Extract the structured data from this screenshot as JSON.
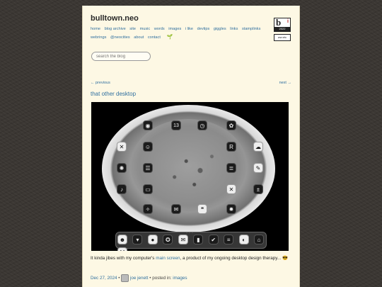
{
  "site": {
    "title": "bulltown.neo",
    "nav": [
      "home",
      "blog archive",
      "site",
      "music",
      "words",
      "images",
      "i like",
      "devtips",
      "giggles",
      "links",
      "stamplinks",
      "webrings",
      "@neocities",
      "about",
      "contact"
    ],
    "sprout_icon": "sprout-icon"
  },
  "badges": {
    "logo_letter": "b",
    "logo_accent": "i",
    "year": "2022",
    "webmaster": "ww:etc"
  },
  "search": {
    "placeholder": "search the blog"
  },
  "pager": {
    "prev": "← previous",
    "next": "next →"
  },
  "post": {
    "title": "that other desktop",
    "caption_before": "It kinda jibes with my computer's ",
    "caption_link": "main screen",
    "caption_after": ", a product of my ongoing desktop design therapy... 😎",
    "date": "Dec 27, 2024",
    "separator": " •",
    "author": "joe jenett",
    "posted_in_label": " • posted in: ",
    "category": "images"
  },
  "screenshot": {
    "calendar_day": "13",
    "ring_icons": [
      "person",
      "13",
      "clock",
      "flower",
      "checker",
      "alien",
      "cloud",
      "brain",
      "R",
      "stack",
      "notes",
      "music",
      "x",
      "calc",
      "radio",
      "yoga",
      "mail",
      "chat",
      "fire"
    ],
    "dock_icons": [
      "face",
      "cup",
      "chat",
      "compass",
      "mail",
      "chart",
      "check",
      "list",
      "toggle",
      "home",
      "M"
    ]
  },
  "colors": {
    "link": "#2f6f9f",
    "page_bg": "#fdf8e4",
    "body_bg": "#3b3733"
  }
}
